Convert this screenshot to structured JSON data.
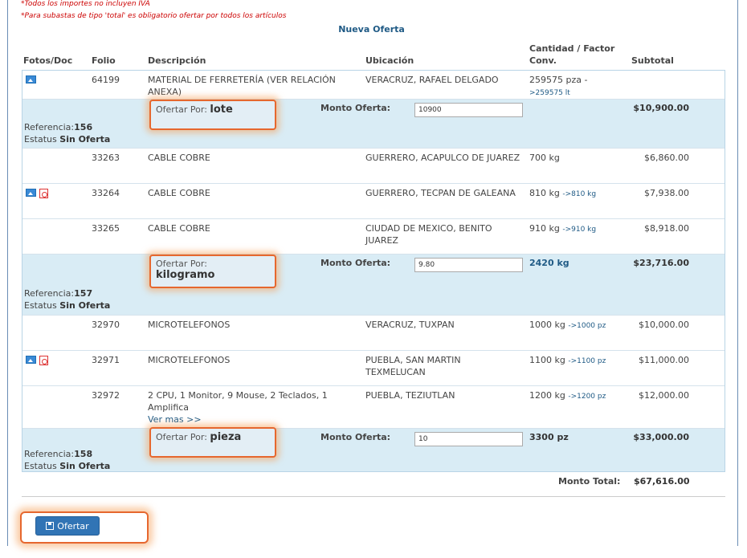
{
  "notes": [
    "*Todos los importes no incluyen IVA",
    "*Para subastas de tipo 'total' es obligatorio ofertar por todos los artículos"
  ],
  "section_title": "Nueva Oferta",
  "headers": {
    "fotos": "Fotos/Doc",
    "folio": "Folio",
    "descripcion": "Descripción",
    "ubicacion": "Ubicación",
    "cantidad_1": "Cantidad / Factor",
    "cantidad_2": "Conv.",
    "subtotal": "Subtotal"
  },
  "items": [
    {
      "folio": "64199",
      "desc": "MATERIAL DE FERRETERÍA (VER RELACIÓN ANEXA)",
      "ubic": "VERACRUZ, RAFAEL DELGADO",
      "cant": "259575 pza -",
      "conv": ">259575 lt",
      "sub": "",
      "icons": [
        "image-icon"
      ]
    },
    {
      "folio": "33263",
      "desc": "CABLE COBRE",
      "ubic": "GUERRERO, ACAPULCO DE JUAREZ",
      "cant": "700 kg",
      "conv": "",
      "sub": "$6,860.00",
      "icons": []
    },
    {
      "folio": "33264",
      "desc": "CABLE COBRE",
      "ubic": "GUERRERO, TECPAN DE GALEANA",
      "cant": "810 kg",
      "conv": "->810 kg",
      "sub": "$7,938.00",
      "icons": [
        "image-icon",
        "pdf-icon"
      ]
    },
    {
      "folio": "33265",
      "desc": "CABLE COBRE",
      "ubic": "CIUDAD DE MEXICO, BENITO JUAREZ",
      "cant": "910 kg",
      "conv": "->910 kg",
      "sub": "$8,918.00",
      "icons": []
    },
    {
      "folio": "32970",
      "desc": "MICROTELEFONOS",
      "ubic": "VERACRUZ, TUXPAN",
      "cant": "1000 kg",
      "conv": "->1000 pz",
      "sub": "$10,000.00",
      "icons": []
    },
    {
      "folio": "32971",
      "desc": "MICROTELEFONOS",
      "ubic": "PUEBLA, SAN MARTIN TEXMELUCAN",
      "cant": "1100 kg",
      "conv": "->1100 pz",
      "sub": "$11,000.00",
      "icons": [
        "image-icon",
        "pdf-icon"
      ]
    },
    {
      "folio": "32972",
      "desc": "2 CPU, 1 Monitor, 9 Mouse, 2 Teclados, 1 Amplifica",
      "more": "Ver mas >>",
      "ubic": "PUEBLA, TEZIUTLAN",
      "cant": "1200 kg",
      "conv": "->1200 pz",
      "sub": "$12,000.00",
      "icons": []
    }
  ],
  "groups": [
    {
      "ofertar_label": "Ofertar Por:",
      "ofertar_unit": "lote",
      "monto_label": "Monto Oferta:",
      "monto_value": "10900",
      "qty": "",
      "subtotal": "$10,900.00",
      "ref_label": "Referencia:",
      "ref_value": "156",
      "estatus_label": "Estatus",
      "estatus_value": "Sin Oferta"
    },
    {
      "ofertar_label": "Ofertar Por:",
      "ofertar_unit": "kilogramo",
      "monto_label": "Monto Oferta:",
      "monto_value": "9.80",
      "qty": "2420 kg",
      "subtotal": "$23,716.00",
      "ref_label": "Referencia:",
      "ref_value": "157",
      "estatus_label": "Estatus",
      "estatus_value": "Sin Oferta"
    },
    {
      "ofertar_label": "Ofertar Por:",
      "ofertar_unit": "pieza",
      "monto_label": "Monto Oferta:",
      "monto_value": "10",
      "qty": "3300 pz",
      "subtotal": "$33,000.00",
      "ref_label": "Referencia:",
      "ref_value": "158",
      "estatus_label": "Estatus",
      "estatus_value": "Sin Oferta"
    }
  ],
  "total": {
    "label": "Monto Total:",
    "value": "$67,616.00"
  },
  "button": {
    "label": "Ofertar",
    "icon": "save-icon"
  },
  "colors": {
    "accent": "#1f5a85",
    "group_bg": "#d9ecf5",
    "highlight": "#e6672e",
    "button": "#3174b5",
    "note": "#cc0000"
  }
}
